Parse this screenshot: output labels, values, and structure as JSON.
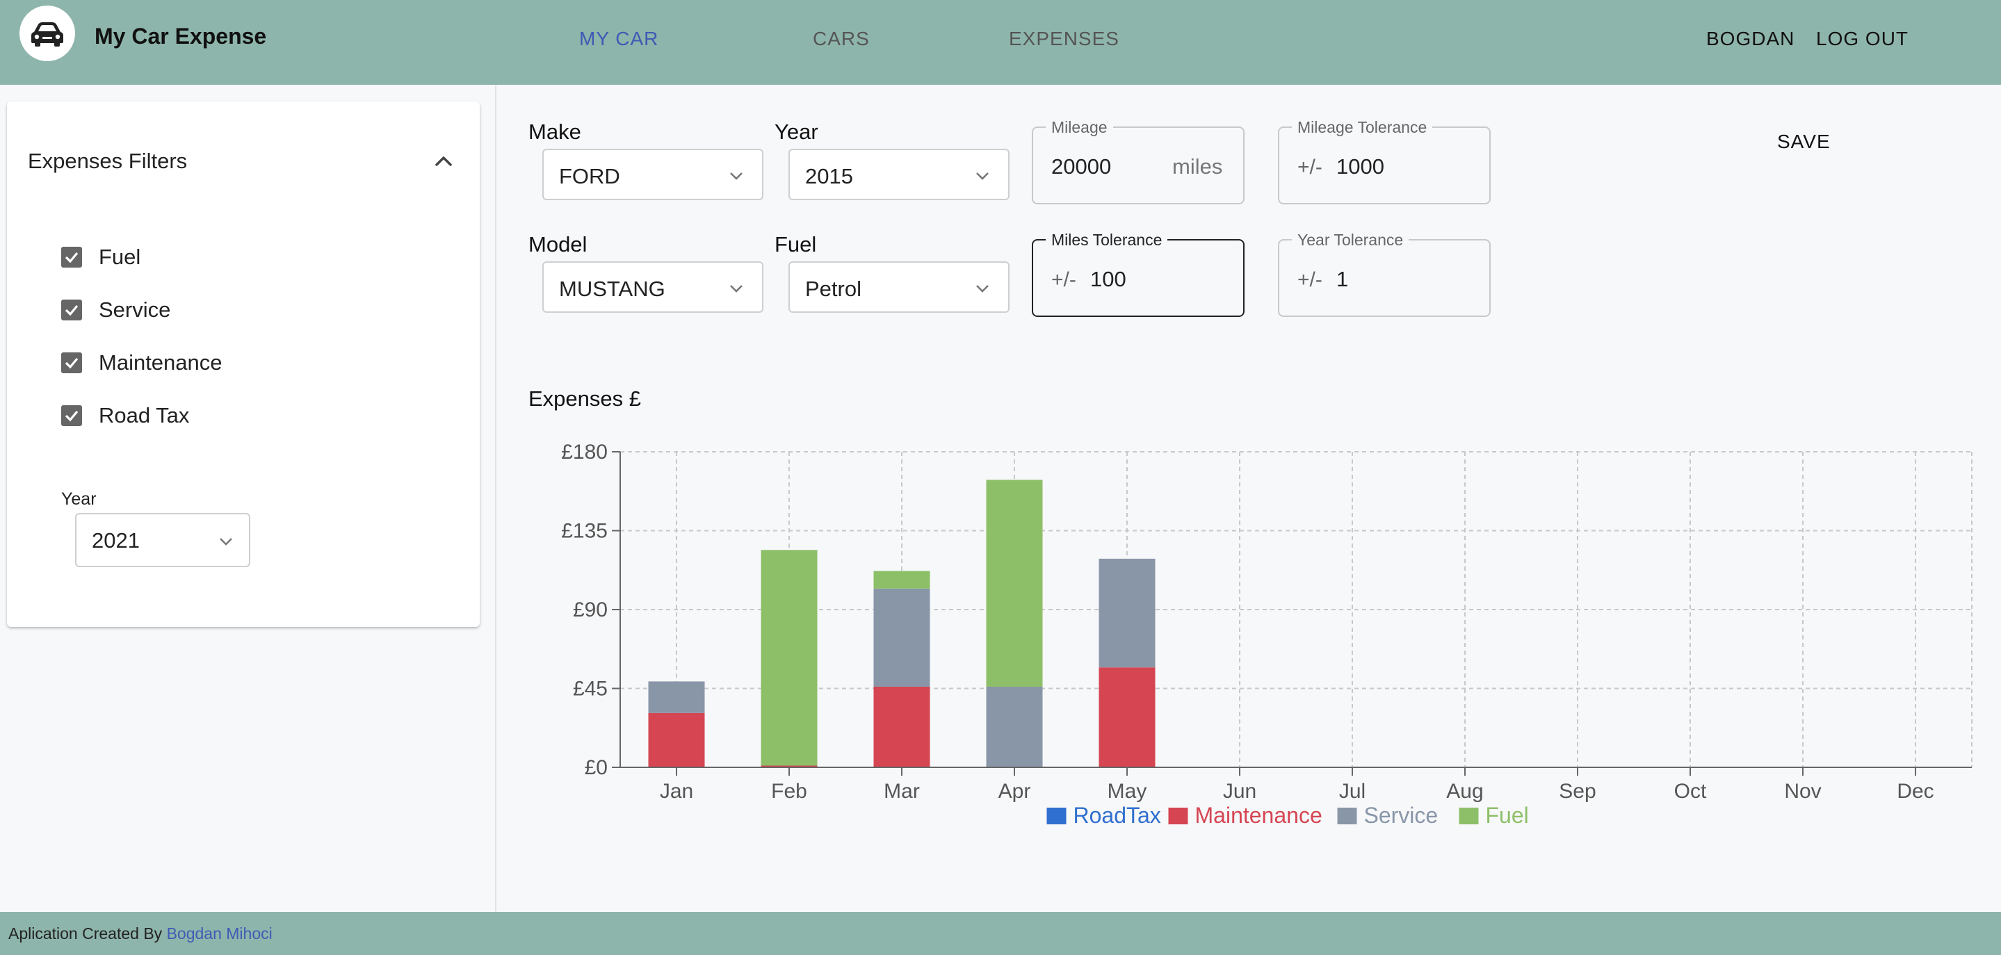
{
  "app": {
    "title": "My Car Expense",
    "logo_icon": "car-icon"
  },
  "nav": {
    "items": [
      {
        "label": "MY CAR",
        "active": true
      },
      {
        "label": "CARS",
        "active": false
      },
      {
        "label": "EXPENSES",
        "active": false
      }
    ],
    "user": "BOGDAN",
    "logout": "LOG OUT"
  },
  "filters": {
    "title": "Expenses Filters",
    "items": [
      {
        "label": "Fuel",
        "checked": true
      },
      {
        "label": "Service",
        "checked": true
      },
      {
        "label": "Maintenance",
        "checked": true
      },
      {
        "label": "Road Tax",
        "checked": true
      }
    ],
    "year_label": "Year",
    "year_value": "2021"
  },
  "car_form": {
    "make_label": "Make",
    "make_value": "FORD",
    "year_label": "Year",
    "year_value": "2015",
    "model_label": "Model",
    "model_value": "MUSTANG",
    "fuel_label": "Fuel",
    "fuel_value": "Petrol",
    "mileage_label": "Mileage",
    "mileage_value": "20000",
    "mileage_unit": "miles",
    "mileage_tolerance_label": "Mileage Tolerance",
    "mileage_tolerance_prefix": "+/-",
    "mileage_tolerance_value": "1000",
    "miles_tolerance_label": "Miles Tolerance",
    "miles_tolerance_prefix": "+/-",
    "miles_tolerance_value": "100",
    "year_tolerance_label": "Year Tolerance",
    "year_tolerance_prefix": "+/-",
    "year_tolerance_value": "1",
    "save_label": "SAVE"
  },
  "chart_data": {
    "type": "bar",
    "stacked": true,
    "title": "Expenses £",
    "categories": [
      "Jan",
      "Feb",
      "Mar",
      "Apr",
      "May",
      "Jun",
      "Jul",
      "Aug",
      "Sep",
      "Oct",
      "Nov",
      "Dec"
    ],
    "ylim": [
      0,
      180
    ],
    "yticks": [
      0,
      45,
      90,
      135,
      180
    ],
    "ytick_labels": [
      "£0",
      "£45",
      "£90",
      "£135",
      "£180"
    ],
    "grid": true,
    "legend_position": "bottom-center",
    "series": [
      {
        "name": "RoadTax",
        "color": "#2f6fcf",
        "values": [
          0,
          0,
          0,
          0,
          0,
          0,
          0,
          0,
          0,
          0,
          0,
          0
        ]
      },
      {
        "name": "Maintenance",
        "color": "#d54552",
        "values": [
          31,
          1,
          46,
          0,
          57,
          0,
          0,
          0,
          0,
          0,
          0,
          0
        ]
      },
      {
        "name": "Service",
        "color": "#8996a8",
        "values": [
          18,
          0,
          56,
          46,
          62,
          0,
          0,
          0,
          0,
          0,
          0,
          0
        ]
      },
      {
        "name": "Fuel",
        "color": "#8dbf68",
        "values": [
          0,
          123,
          10,
          118,
          0,
          0,
          0,
          0,
          0,
          0,
          0,
          0
        ]
      }
    ]
  },
  "footer": {
    "text": "Aplication Created By ",
    "author": "Bogdan Mihoci"
  }
}
